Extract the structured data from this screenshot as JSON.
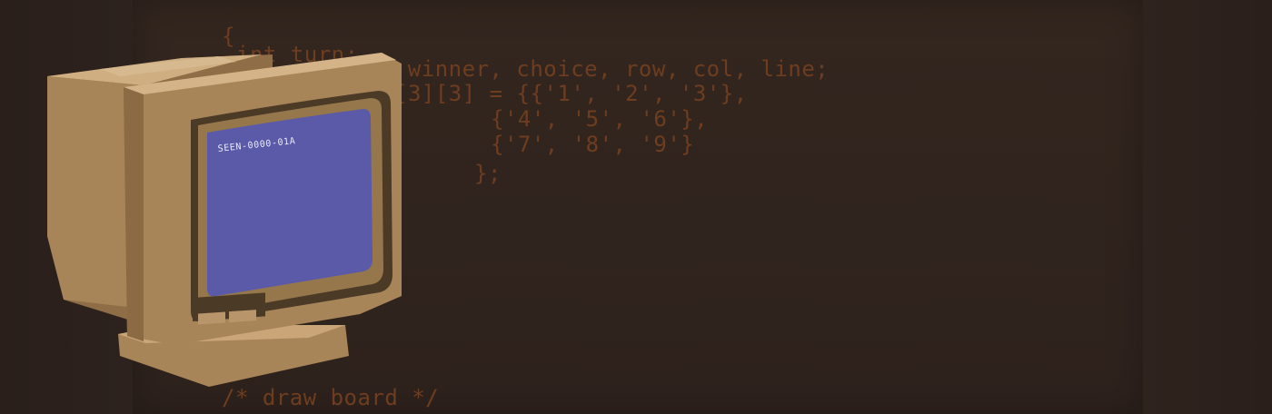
{
  "code": {
    "lines": [
      "{",
      "int turn;",
      "int winner, choice, row, col, line;",
      "[3][3] = {{'1', '2', '3'},",
      "{'4', '5', '6'},",
      "{'7', '8', '9'}",
      "};",
      "/* draw board */"
    ]
  },
  "monitor": {
    "screen_text": "SEEN-0000-01A"
  },
  "colors": {
    "background": "#2b201b",
    "code_text": "#6e3d20",
    "monitor_body": "#a88459",
    "monitor_highlight": "#c9a578",
    "screen": "#5a5aa8",
    "bezel": "#4b3a25"
  }
}
